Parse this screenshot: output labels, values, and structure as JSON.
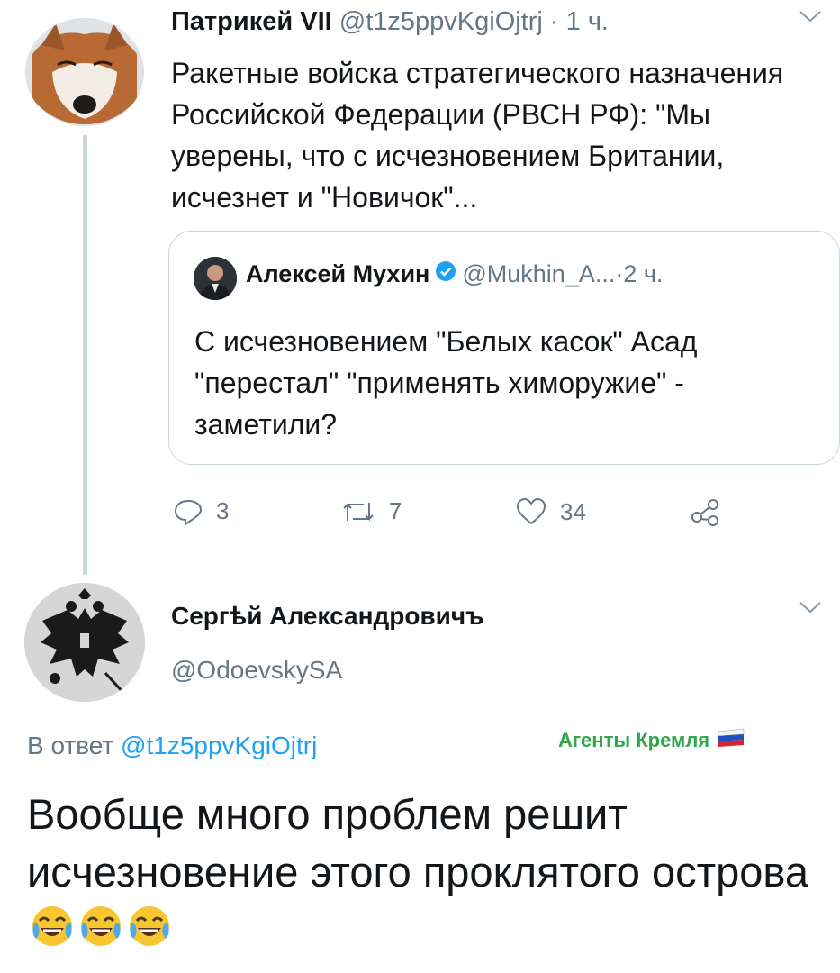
{
  "tweet1": {
    "author_name": "Патрикей VII",
    "handle": "@t1z5ppvKgiOjtrj",
    "separator": " · ",
    "time": "1 ч.",
    "text": "Ракетные войска стратегического назначения Российской Федерации (РВСН РФ): \"Мы уверены, что с исчезновением Британии, исчезнет и \"Новичок\"..."
  },
  "quote": {
    "author_name": "Алексей Мухин",
    "handle": "@Mukhin_A...",
    "separator": " · ",
    "time": "2 ч.",
    "text": "С исчезновением \"Белых касок\" Асад \"перестал\" \"применять химоружие\" - заметили?"
  },
  "actions": {
    "replies": "3",
    "retweets": "7",
    "likes": "34",
    "icons": [
      "reply-icon",
      "retweet-icon",
      "like-icon",
      "share-icon"
    ]
  },
  "tweet2": {
    "author_name": "Сергѣй Александровичъ",
    "handle": "@OdoevskySA",
    "reply_prefix": "В ответ ",
    "reply_handle": "@t1z5ppvKgiOjtrj",
    "text": "Вообще много проблем решит исчезновение этого проклятого острова",
    "emoji": [
      "tears-of-joy",
      "tears-of-joy",
      "tears-of-joy"
    ]
  },
  "watermark": {
    "text": "Агенты Кремля"
  },
  "colors": {
    "text": "#14171a",
    "secondary": "#657786",
    "link": "#1da1f2",
    "border": "#ccd6dd",
    "watermark": "#2ea84a",
    "verified": "#1da1f2"
  }
}
